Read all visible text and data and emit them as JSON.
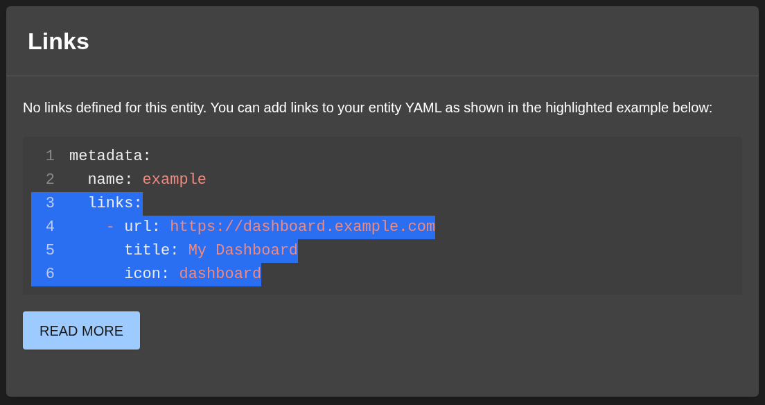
{
  "card": {
    "title": "Links",
    "message": "No links defined for this entity. You can add links to your entity YAML as shown in the highlighted example below:",
    "code_lines": [
      {
        "number": "1",
        "key": "metadata:",
        "highlighted": false
      },
      {
        "number": "2",
        "key": "  name:",
        "value": "example",
        "highlighted": false
      },
      {
        "number": "3",
        "key": "  links:",
        "highlighted": true
      },
      {
        "number": "4",
        "marker": "    -",
        "key": " url:",
        "value": "https://dashboard.example.com",
        "highlighted": true
      },
      {
        "number": "5",
        "key": "      title:",
        "value": "My Dashboard",
        "highlighted": true
      },
      {
        "number": "6",
        "key": "      icon:",
        "value": "dashboard",
        "highlighted": true
      }
    ],
    "button": "READ MORE"
  }
}
